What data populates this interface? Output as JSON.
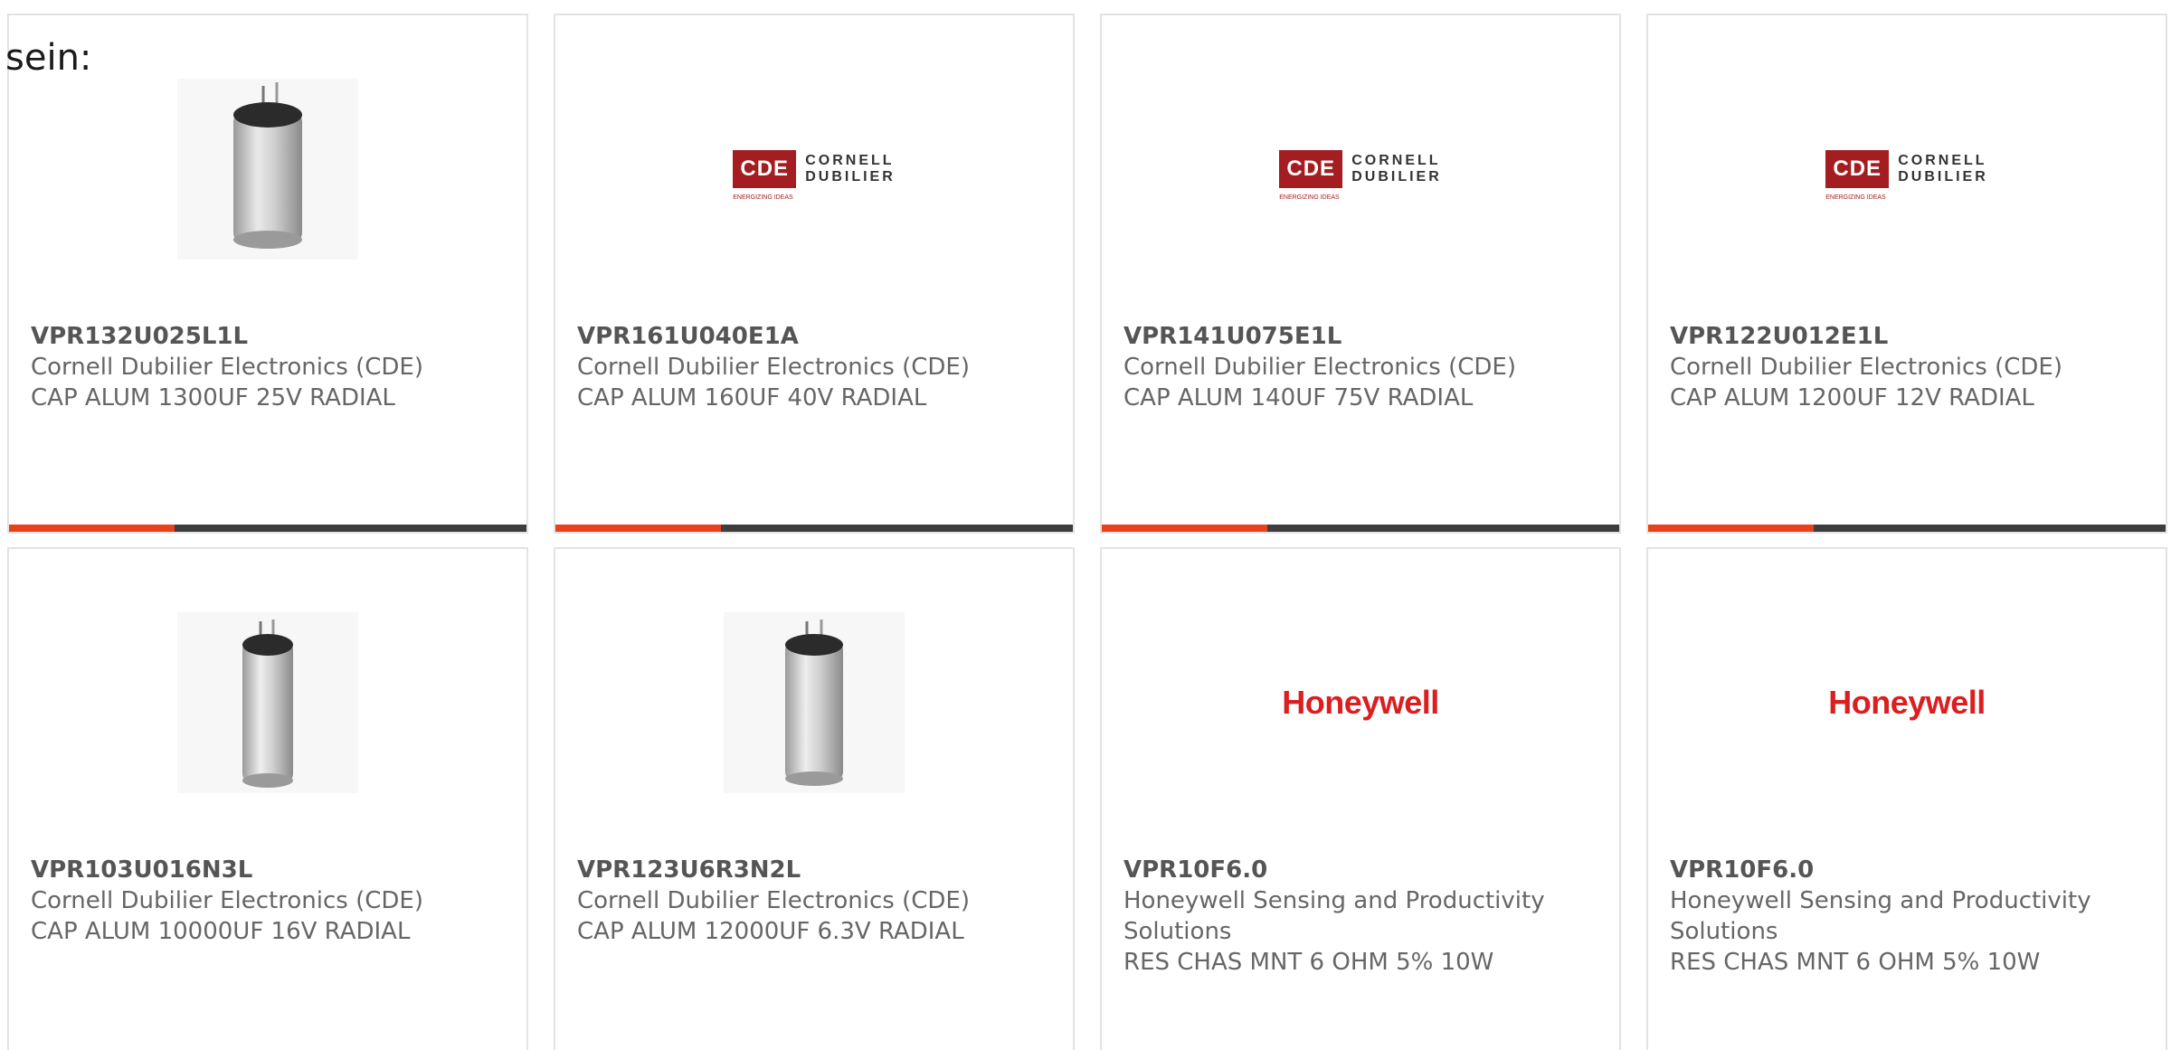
{
  "intro": {
    "text": "sein:"
  },
  "logos": {
    "cde": {
      "box_text": "CDE",
      "word1": "CORNELL",
      "word2": "DUBILIER",
      "tagline": "ENERGIZING IDEAS",
      "color": "#a31d21"
    },
    "honeywell": {
      "text": "Honeywell",
      "color": "#dc1e1e"
    }
  },
  "accent_color": "#e8421c",
  "products": [
    {
      "part_number": "VPR132U025L1L",
      "manufacturer": "Cornell Dubilier Electronics (CDE)",
      "description": "CAP ALUM 1300UF 25V RADIAL",
      "image": "capacitor-photo",
      "progress": 0.32
    },
    {
      "part_number": "VPR161U040E1A",
      "manufacturer": "Cornell Dubilier Electronics (CDE)",
      "description": "CAP ALUM 160UF 40V RADIAL",
      "image": "cde-logo",
      "progress": 0.32
    },
    {
      "part_number": "VPR141U075E1L",
      "manufacturer": "Cornell Dubilier Electronics (CDE)",
      "description": "CAP ALUM 140UF 75V RADIAL",
      "image": "cde-logo",
      "progress": 0.32
    },
    {
      "part_number": "VPR122U012E1L",
      "manufacturer": "Cornell Dubilier Electronics (CDE)",
      "description": "CAP ALUM 1200UF 12V RADIAL",
      "image": "cde-logo",
      "progress": 0.32
    },
    {
      "part_number": "VPR103U016N3L",
      "manufacturer": "Cornell Dubilier Electronics (CDE)",
      "description": "CAP ALUM 10000UF 16V RADIAL",
      "image": "capacitor-photo"
    },
    {
      "part_number": "VPR123U6R3N2L",
      "manufacturer": "Cornell Dubilier Electronics (CDE)",
      "description": "CAP ALUM 12000UF 6.3V RADIAL",
      "image": "capacitor-photo"
    },
    {
      "part_number": "VPR10F6.0",
      "manufacturer": "Honeywell Sensing and Productivity Solutions",
      "description": "RES CHAS MNT 6 OHM 5% 10W",
      "image": "honeywell-logo"
    },
    {
      "part_number": "VPR10F6.0",
      "manufacturer": "Honeywell Sensing and Productivity Solutions",
      "description": "RES CHAS MNT 6 OHM 5% 10W",
      "image": "honeywell-logo"
    }
  ]
}
